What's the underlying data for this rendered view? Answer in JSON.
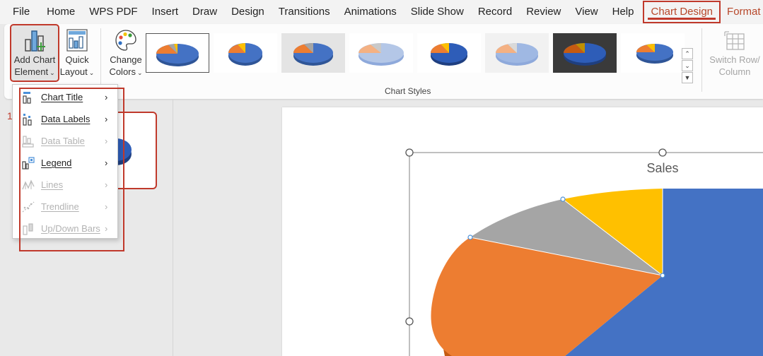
{
  "menubar": {
    "items": [
      "File",
      "Home",
      "WPS PDF",
      "Insert",
      "Draw",
      "Design",
      "Transitions",
      "Animations",
      "Slide Show",
      "Record",
      "Review",
      "View",
      "Help"
    ],
    "active_tab": "Chart Design",
    "format_tab": "Format"
  },
  "ribbon": {
    "add_chart_line1": "Add Chart",
    "add_chart_line2": "Element",
    "quick_layout_line1": "Quick",
    "quick_layout_line2": "Layout",
    "change_colors_line1": "Change",
    "change_colors_line2": "Colors",
    "chart_styles_label": "Chart Styles",
    "switch_row_line1": "Switch Row/",
    "switch_row_line2": "Column"
  },
  "dropdown": {
    "items": [
      {
        "label": "Chart Title",
        "enabled": true,
        "icon": "chart-title-icon"
      },
      {
        "label": "Data Labels",
        "enabled": true,
        "icon": "data-labels-icon"
      },
      {
        "label": "Data Table",
        "enabled": false,
        "icon": "data-table-icon"
      },
      {
        "label": "Legend",
        "enabled": true,
        "icon": "legend-icon"
      },
      {
        "label": "Lines",
        "enabled": false,
        "icon": "lines-icon"
      },
      {
        "label": "Trendline",
        "enabled": false,
        "icon": "trendline-icon"
      },
      {
        "label": "Up/Down Bars",
        "enabled": false,
        "icon": "up-down-bars-icon"
      }
    ]
  },
  "slide_pane": {
    "slide_number": "1"
  },
  "chart": {
    "title": "Sales"
  },
  "colors": {
    "accent_red": "#c0392b",
    "pie_blue": "#4472c4",
    "pie_orange": "#ed7d31",
    "pie_gray": "#a5a5a5",
    "pie_yellow": "#ffc000"
  }
}
